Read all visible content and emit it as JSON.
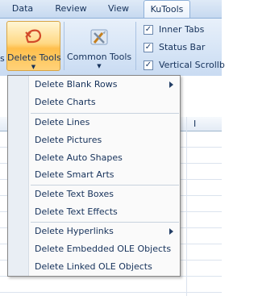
{
  "tabs": [
    "Data",
    "Review",
    "View",
    "KuTools"
  ],
  "ribbon": {
    "partial_button_label": "s",
    "delete_tools_label": "Delete Tools",
    "common_tools_label": "Common Tools",
    "dropdown_arrow": "▼",
    "checkboxes": [
      {
        "label": "Inner Tabs",
        "checked": true
      },
      {
        "label": "Status Bar",
        "checked": true
      },
      {
        "label": "Vertical Scrollb",
        "checked": true
      }
    ],
    "check_mark": "✓"
  },
  "sheet": {
    "column_header_fragment": "I"
  },
  "menu": {
    "items": [
      {
        "label": "Delete Blank Rows",
        "submenu": true
      },
      {
        "label": "Delete Charts",
        "submenu": false
      },
      {
        "label": "Delete Lines",
        "submenu": false
      },
      {
        "label": "Delete Pictures",
        "submenu": false
      },
      {
        "label": "Delete Auto Shapes",
        "submenu": false
      },
      {
        "label": "Delete Smart Arts",
        "submenu": false
      },
      {
        "label": "Delete Text Boxes",
        "submenu": false
      },
      {
        "label": "Delete Text Effects",
        "submenu": false
      },
      {
        "label": "Delete Hyperlinks",
        "submenu": true
      },
      {
        "label": "Delete Embedded OLE Objects",
        "submenu": false
      },
      {
        "label": "Delete Linked OLE Objects",
        "submenu": false
      }
    ]
  },
  "colors": {
    "accent_hover": "#ffd27a",
    "ribbon_blue": "#d7e5f6",
    "text": "#15315a"
  }
}
